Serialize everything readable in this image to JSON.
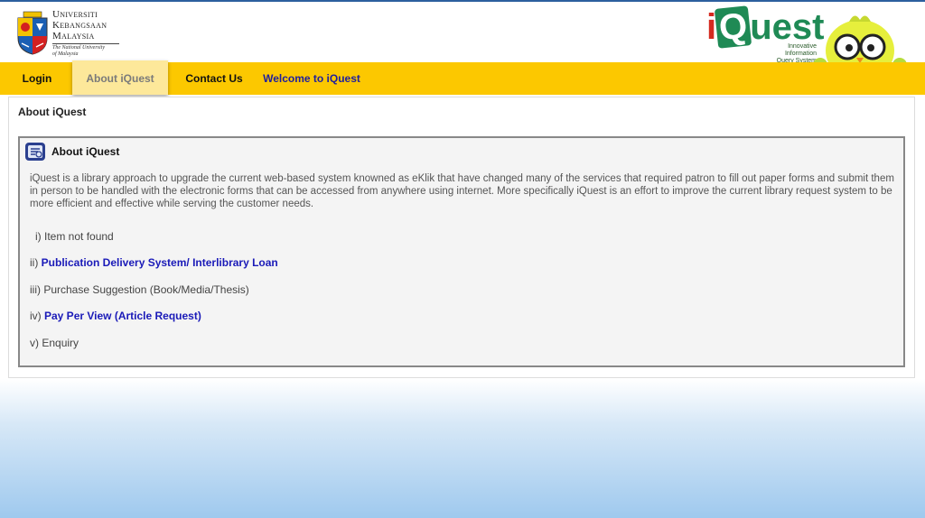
{
  "header": {
    "university": {
      "line1": "Universiti",
      "line2": "Kebangsaan",
      "line3": "Malaysia",
      "sub1": "The National University",
      "sub2": "of Malaysia"
    },
    "brand": {
      "i": "i",
      "q": "Q",
      "rest": "uest",
      "tagline1": "Innovative Information",
      "tagline2": "Query System"
    }
  },
  "nav": {
    "login": "Login",
    "about": "About iQuest",
    "contact": "Contact Us",
    "welcome": "Welcome to iQuest",
    "active": "about"
  },
  "main": {
    "page_title": "About iQuest",
    "box_title": "About iQuest",
    "description": "iQuest is a library approach to upgrade the current web-based system knowned as eKlik that have changed many of the services that required patron to fill out paper forms and submit them in person to be handled with the electronic forms that can be accessed from anywhere using internet. More specifically iQuest is an effort to improve the current library request system to be more efficient and effective while serving the customer needs.",
    "items": [
      {
        "prefix": "i) ",
        "text": "Item not found"
      },
      {
        "prefix": "ii) ",
        "link": "Publication Delivery System/ Interlibrary Loan"
      },
      {
        "prefix": "iii) ",
        "text": "Purchase Suggestion (Book/Media/Thesis)"
      },
      {
        "prefix": "iv) ",
        "link": "Pay Per View (Article Request)"
      },
      {
        "prefix": "v) ",
        "text": "Enquiry"
      }
    ]
  },
  "colors": {
    "nav_bg": "#fcc800",
    "nav_active_bg": "#fde89a",
    "link": "#1a1ab8",
    "brand_green": "#1f8a55",
    "brand_red": "#d42a20"
  }
}
